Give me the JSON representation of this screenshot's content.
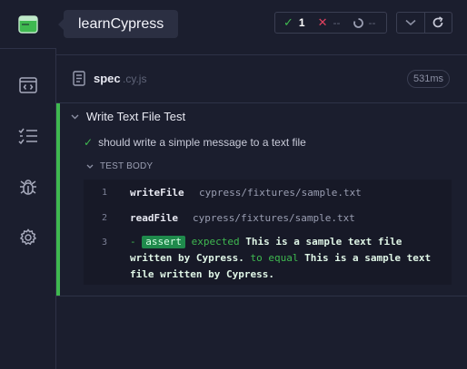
{
  "sidebar": {
    "tooltip": "learnCypress"
  },
  "header": {
    "passed_count": "1",
    "failed_count": "--",
    "pending_count": "--"
  },
  "spec": {
    "name": "spec",
    "ext": ".cy.js",
    "duration": "531ms"
  },
  "suite": {
    "title": "Write Text File Test",
    "test_title": "should write a simple message to a text file",
    "body_label": "TEST BODY",
    "commands": [
      {
        "num": "1",
        "name": "writeFile",
        "message": "cypress/fixtures/sample.txt"
      },
      {
        "num": "2",
        "name": "readFile",
        "message": "cypress/fixtures/sample.txt"
      },
      {
        "num": "3",
        "dash": "-",
        "name": "assert",
        "expected_kw": "expected",
        "expected_val": "This is a sample text file written by Cypress.",
        "to_equal_kw": "to equal",
        "equal_val": "This is a sample text file written by Cypress."
      }
    ]
  },
  "colors": {
    "pass": "#3fb950",
    "fail": "#e0415f",
    "background": "#1b1e2e"
  },
  "icons": {
    "logo": "cypress-app-icon",
    "specs": "browser-code-icon",
    "runs": "list-check-icon",
    "debug": "bug-icon",
    "settings": "gear-icon",
    "collapse": "chevron-down-icon",
    "restart": "refresh-icon"
  }
}
